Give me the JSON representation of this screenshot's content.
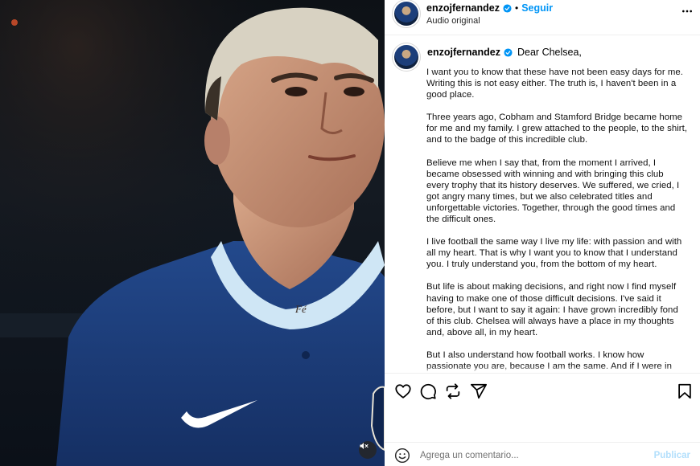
{
  "post": {
    "username": "enzojfernandez",
    "separator": "•",
    "follow_label": "Seguir",
    "audio_label": "Audio original",
    "greeting": "Dear Chelsea,",
    "paragraphs": [
      "I want you to know that these have not been easy days for me. Writing this is not easy either. The truth is, I haven't been in a good place.",
      "Three years ago, Cobham and Stamford Bridge became home for me and my family. I grew attached to the people, to the shirt, and to the badge of this incredible club.",
      "Believe me when I say that, from the moment I arrived, I became obsessed with winning and with bringing this club every trophy that its history deserves. We suffered, we cried, I got angry many times, but we also celebrated titles and unforgettable victories. Together, through the good times and the difficult ones.",
      "I live football the same way I live my life: with passion and with all my heart. That is why I want you to know that I understand you. I truly understand you, from the bottom of my heart.",
      "But life is about making decisions, and right now I find myself having to make one of those difficult decisions. I've said it before, but I want to say it again: I have grown incredibly fond of this club. Chelsea will always have a place in my thoughts and, above all, in my heart.",
      "But I also understand how football works. I know how passionate you are, because I am the same. And if I were in"
    ]
  },
  "media": {
    "neck_tattoo": "Fé",
    "mute_icon": "speaker-muted-icon"
  },
  "actions": {
    "icons": [
      "heart-icon",
      "comment-icon",
      "repost-icon",
      "share-icon",
      "bookmark-icon"
    ]
  },
  "comment": {
    "placeholder": "Agrega un comentario...",
    "publish_label": "Publicar"
  },
  "colors": {
    "link_blue": "#0095f6",
    "publish_disabled": "#b2dffc",
    "verified_blue": "#0095f6",
    "jersey_blue": "#1c3e7a"
  }
}
